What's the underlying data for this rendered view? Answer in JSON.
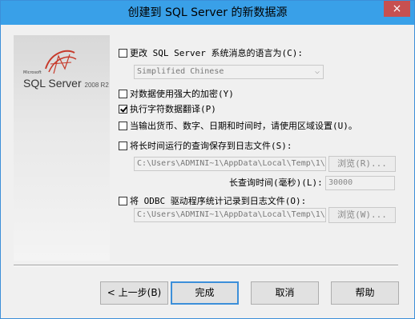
{
  "window": {
    "title": "创建到 SQL Server 的新数据源",
    "close_glyph": "×"
  },
  "logo": {
    "vendor": "Microsoft",
    "product": "SQL Server",
    "version": "2008 R2",
    "icon": "sql-server-logo-icon"
  },
  "options": {
    "change_language": {
      "label": "更改 SQL Server 系统消息的语言为(C):",
      "checked": false
    },
    "language_select": {
      "value": "Simplified Chinese",
      "arrow": "⌵"
    },
    "strong_encryption": {
      "label": "对数据使用强大的加密(Y)",
      "checked": false
    },
    "char_translation": {
      "label": "执行字符数据翻译(P)",
      "checked": true
    },
    "regional_settings": {
      "label": "当输出货币、数字、日期和时间时，请使用区域设置(U)。",
      "checked": false
    },
    "save_long_queries": {
      "label": "将长时间运行的查询保存到日志文件(S):",
      "checked": false
    },
    "long_query_path": {
      "value": "C:\\Users\\ADMINI~1\\AppData\\Local\\Temp\\1\\"
    },
    "browse_r": {
      "label": "浏览(R)..."
    },
    "long_query_time_label": "长查询时间(毫秒)(L):",
    "long_query_time_value": "30000",
    "log_odbc_stats": {
      "label": "将 ODBC 驱动程序统计记录到日志文件(O):",
      "checked": false
    },
    "odbc_stats_path": {
      "value": "C:\\Users\\ADMINI~1\\AppData\\Local\\Temp\\1\\"
    },
    "browse_w": {
      "label": "浏览(W)..."
    }
  },
  "buttons": {
    "back": "< 上一步(B)",
    "finish": "完成",
    "cancel": "取消",
    "help": "帮助"
  }
}
